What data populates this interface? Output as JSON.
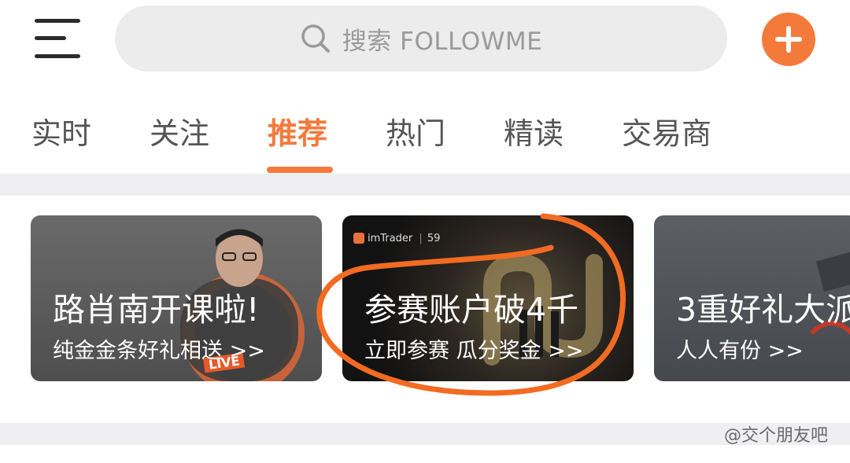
{
  "header": {
    "search_placeholder": "搜索 FOLLOWME",
    "menu_icon": "hamburger-menu-icon",
    "add_icon": "plus-icon",
    "accent_color": "#f47a3c"
  },
  "tabs": [
    {
      "label": "实时"
    },
    {
      "label": "关注"
    },
    {
      "label": "推荐",
      "active": true
    },
    {
      "label": "热门"
    },
    {
      "label": "精读"
    },
    {
      "label": "交易商"
    }
  ],
  "banners": [
    {
      "title": "路肖南开课啦!",
      "subtitle": "纯金金条好礼相送 >>",
      "badge": "LIVE"
    },
    {
      "brand": "imTrader",
      "brand_num": "59",
      "title": "参赛账户破4千",
      "subtitle": "立即参赛 瓜分奖金 >>"
    },
    {
      "title": "3重好礼大派",
      "subtitle": "人人有份 >>"
    }
  ],
  "watermark": "@交个朋友吧"
}
